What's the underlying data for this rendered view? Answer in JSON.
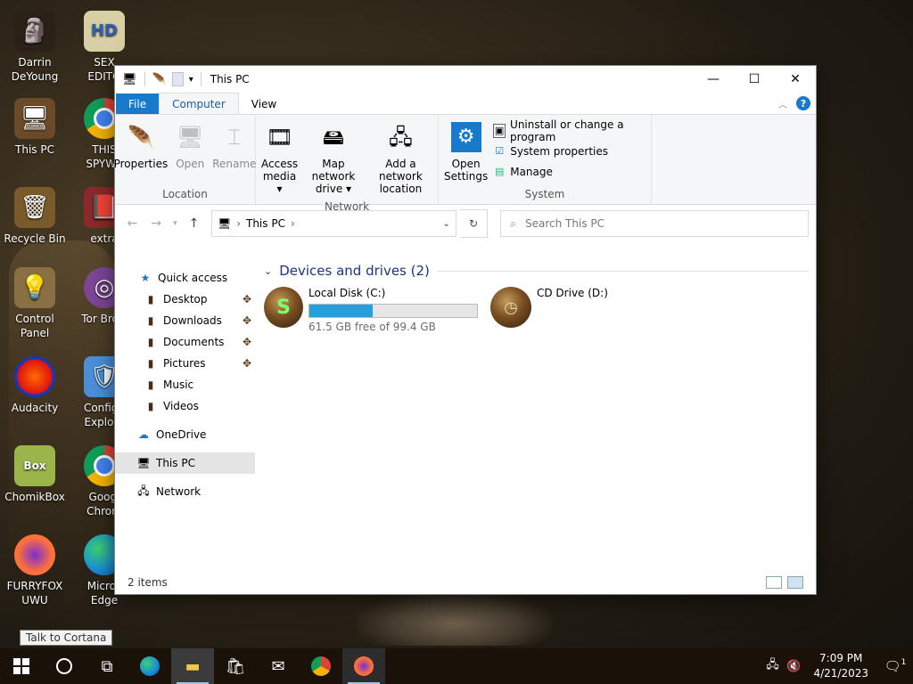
{
  "desktop": {
    "icons": [
      {
        "label": "Darrin\nDeYoung",
        "icon": "person-statue-icon"
      },
      {
        "label": "SEX\nEDITO",
        "icon": "hxd-editor-icon"
      },
      {
        "label": "This PC",
        "icon": "computer-icon"
      },
      {
        "label": "THIS\nSPYWA",
        "icon": "chrome-icon"
      },
      {
        "label": "Recycle Bin",
        "icon": "recycle-bin-icon"
      },
      {
        "label": "extra",
        "icon": "book-icon"
      },
      {
        "label": "Control Panel",
        "icon": "lightbulb-icon"
      },
      {
        "label": "Tor Brow",
        "icon": "tor-icon"
      },
      {
        "label": "Audacity",
        "icon": "audacity-icon"
      },
      {
        "label": "Configu\nExplore",
        "icon": "shield-icon"
      },
      {
        "label": "ChomikBox",
        "icon": "chomikbox-icon"
      },
      {
        "label": "Googl\nChrom",
        "icon": "chrome-icon"
      },
      {
        "label": "FURRYFOX\nUWU",
        "icon": "firefox-icon"
      },
      {
        "label": "Micros\nEdge",
        "icon": "edge-icon"
      }
    ],
    "tooltip": "Talk to Cortana"
  },
  "window": {
    "title": "This PC",
    "tabs": {
      "file": "File",
      "computer": "Computer",
      "view": "View"
    },
    "ribbon": {
      "location": {
        "name": "Location",
        "properties": "Properties",
        "open": "Open",
        "rename": "Rename"
      },
      "network": {
        "name": "Network",
        "access_media_1": "Access",
        "access_media_2": "media ▾",
        "map_drive_1": "Map network",
        "map_drive_2": "drive ▾",
        "add_location_1": "Add a network",
        "add_location_2": "location"
      },
      "system": {
        "name": "System",
        "open_settings_1": "Open",
        "open_settings_2": "Settings",
        "uninstall": "Uninstall or change a program",
        "sys_props": "System properties",
        "manage": "Manage"
      }
    },
    "address": {
      "path": "This PC",
      "search_placeholder": "Search This PC"
    },
    "nav": {
      "quick_access": "Quick access",
      "desktop": "Desktop",
      "downloads": "Downloads",
      "documents": "Documents",
      "pictures": "Pictures",
      "music": "Music",
      "videos": "Videos",
      "onedrive": "OneDrive",
      "this_pc": "This PC",
      "network": "Network"
    },
    "main": {
      "group_title": "Devices and drives (2)",
      "drives": [
        {
          "name": "Local Disk (C:)",
          "free": "61.5 GB free of 99.4 GB",
          "used_fraction": 0.38
        },
        {
          "name": "CD Drive (D:)"
        }
      ]
    },
    "status": {
      "items": "2 items"
    }
  },
  "taskbar": {
    "time": "7:09 PM",
    "date": "4/21/2023",
    "notification_count": "1"
  },
  "colors": {
    "accent": "#1979ca",
    "progress": "#26a0da"
  }
}
